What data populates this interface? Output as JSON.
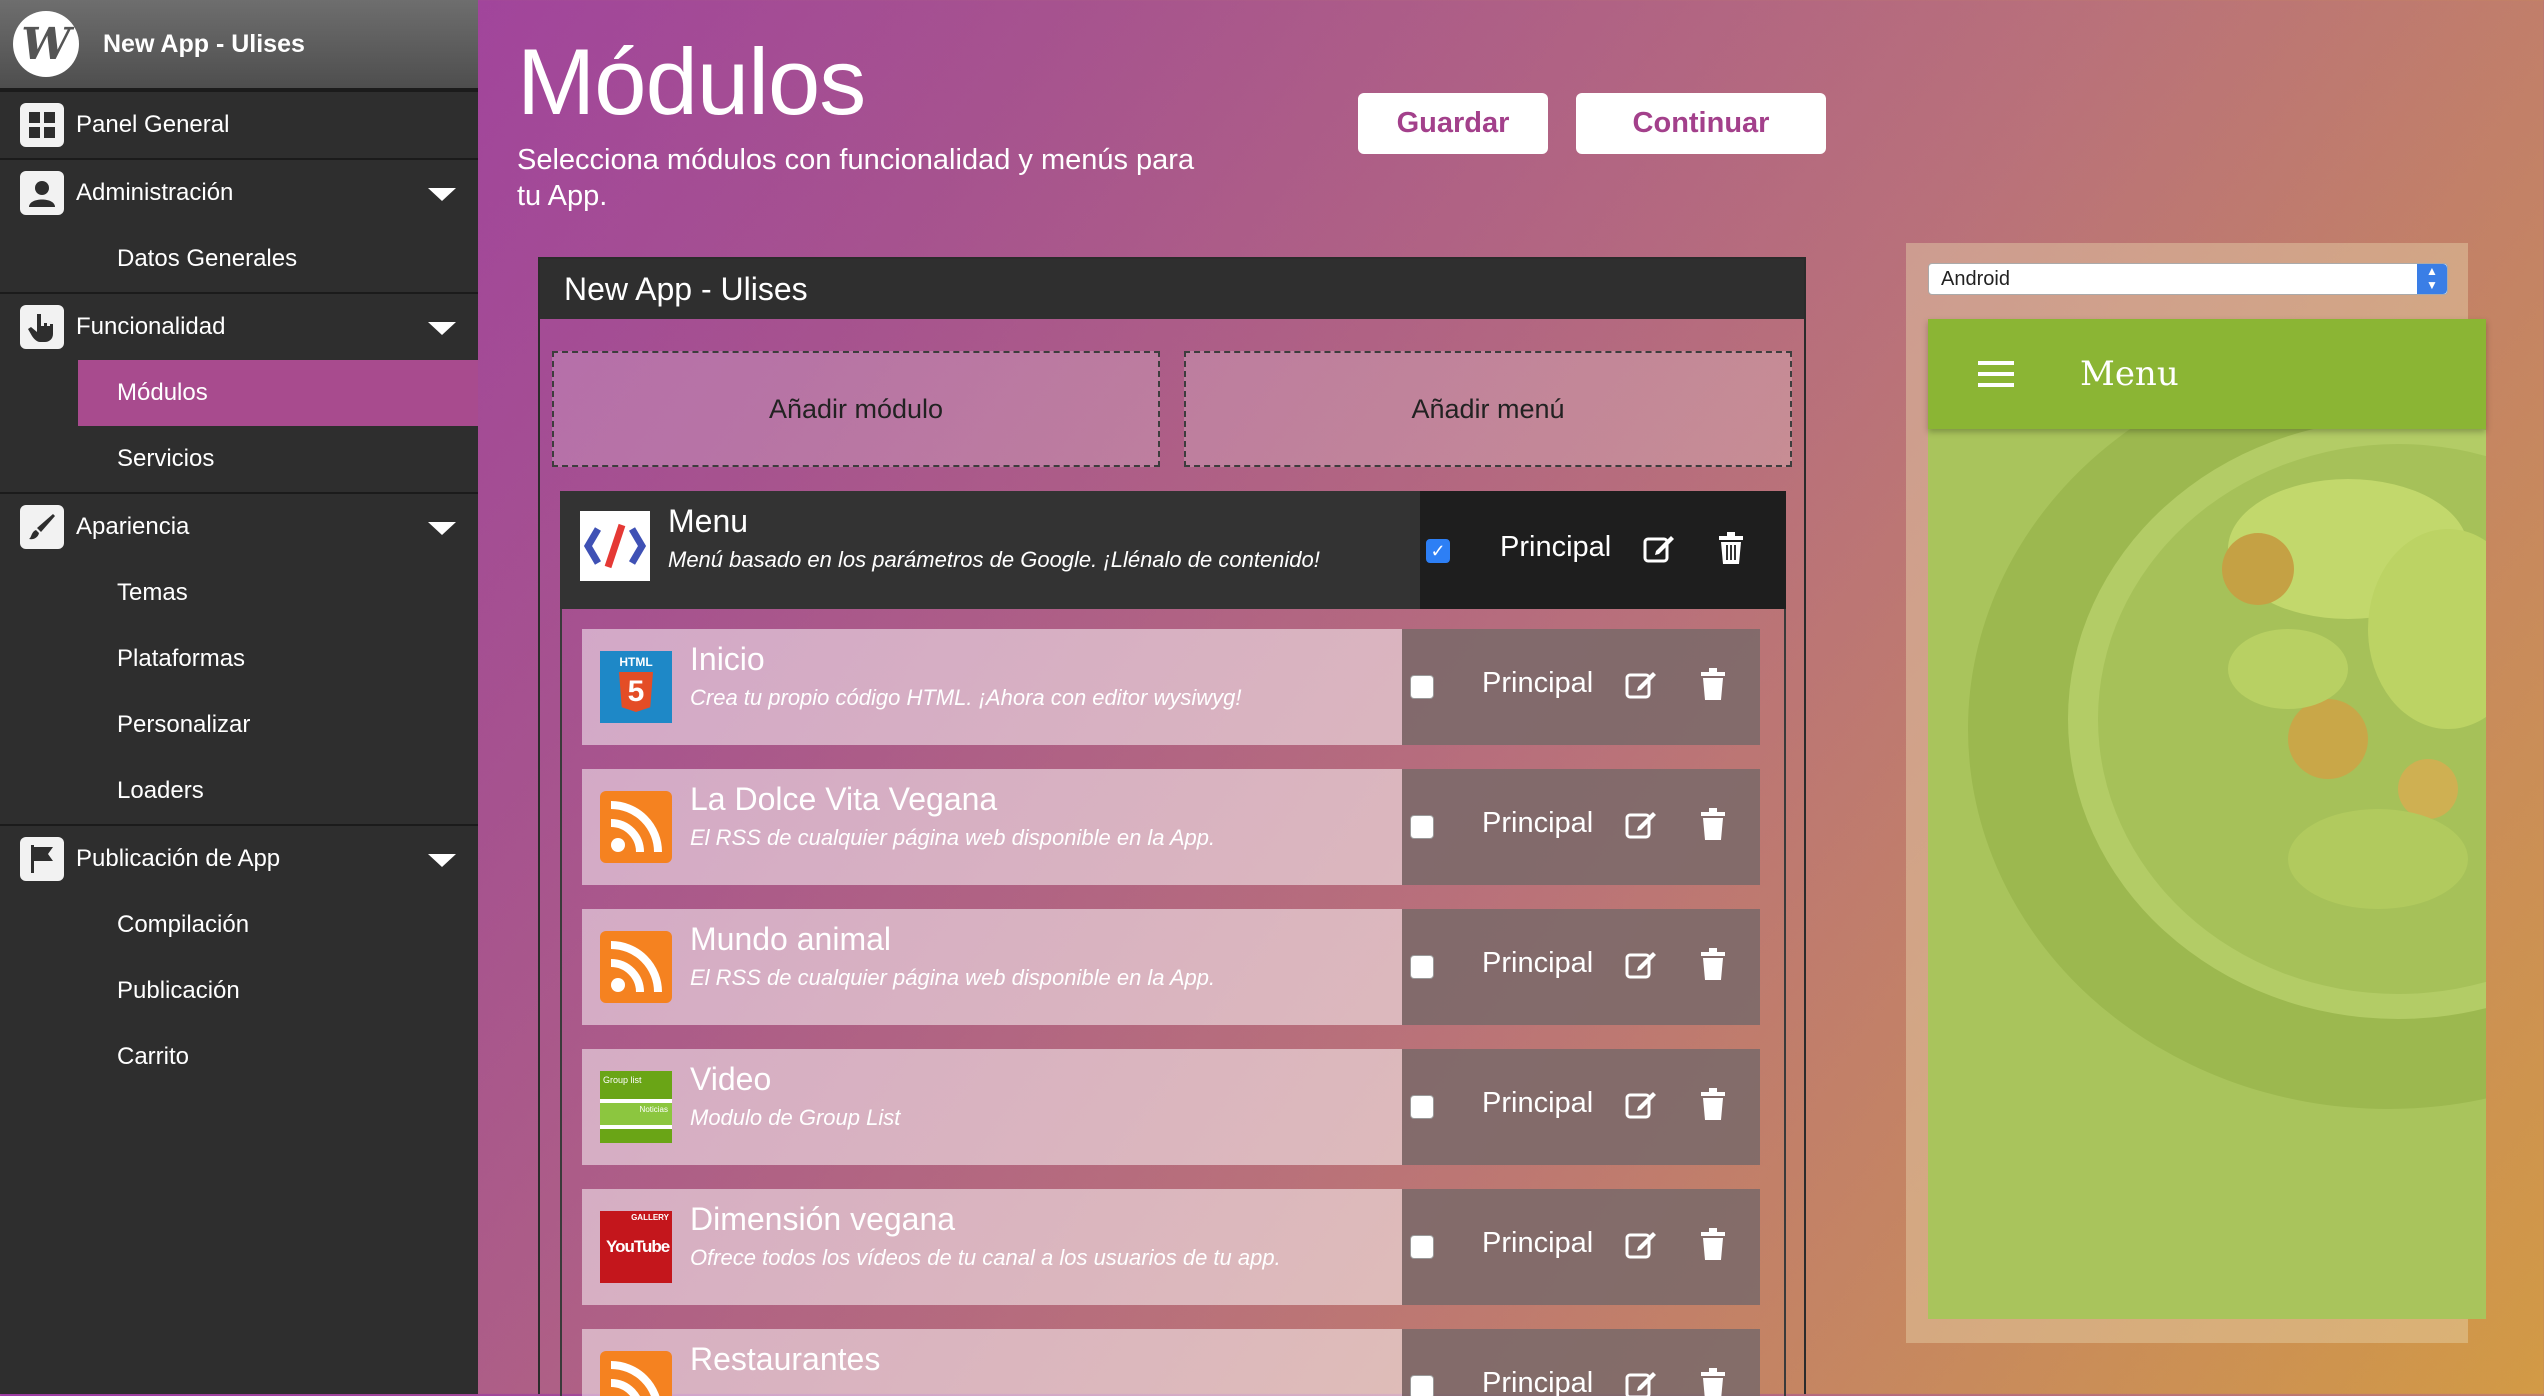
{
  "sidebar": {
    "brand": "New App - Ulises",
    "logo_letter": "W",
    "items": [
      {
        "label": "Panel General",
        "icon": "dashboard-icon"
      },
      {
        "label": "Administración",
        "icon": "user-icon",
        "subs": [
          "Datos Generales"
        ]
      },
      {
        "label": "Funcionalidad",
        "icon": "hand-pointer-icon",
        "subs": [
          "Módulos",
          "Servicios"
        ],
        "active": "Módulos"
      },
      {
        "label": "Apariencia",
        "icon": "brush-icon",
        "subs": [
          "Temas",
          "Plataformas",
          "Personalizar",
          "Loaders"
        ]
      },
      {
        "label": "Publicación de App",
        "icon": "flag-icon",
        "subs": [
          "Compilación",
          "Publicación",
          "Carrito"
        ]
      }
    ]
  },
  "header": {
    "title": "Módulos",
    "subtitle": "Selecciona módulos con funcionalidad y menús para tu App.",
    "save_label": "Guardar",
    "continue_label": "Continuar"
  },
  "panel": {
    "title": "New App - Ulises",
    "add_module": "Añadir módulo",
    "add_menu": "Añadir menú",
    "menu": {
      "name": "Menu",
      "desc": "Menú basado en los parámetros de Google. ¡Llénalo de contenido!",
      "principal": "Principal",
      "checked": true
    },
    "modules": [
      {
        "name": "Inicio",
        "desc": "Crea tu propio código HTML. ¡Ahora con editor wysiwyg!",
        "icon": "html5-icon",
        "principal": "Principal"
      },
      {
        "name": "La Dolce Vita Vegana",
        "desc": "El RSS de cualquier página web disponible en la App.",
        "icon": "rss-icon",
        "principal": "Principal"
      },
      {
        "name": "Mundo animal",
        "desc": "El RSS de cualquier página web disponible en la App.",
        "icon": "rss-icon",
        "principal": "Principal"
      },
      {
        "name": "Video",
        "desc": "Modulo de Group List",
        "icon": "group-list-icon",
        "principal": "Principal"
      },
      {
        "name": "Dimensión vegana",
        "desc": "Ofrece todos los vídeos de tu canal a los usuarios de tu app.",
        "icon": "youtube-icon",
        "principal": "Principal"
      },
      {
        "name": "Restaurantes",
        "desc": "",
        "icon": "rss-icon",
        "principal": "Principal"
      }
    ],
    "icon_texts": {
      "html": "HTML",
      "html_num": "5",
      "group1": "Group list",
      "group2": "Noticias",
      "yt_top": "GALLERY",
      "yt": "YouTube"
    }
  },
  "preview": {
    "platform": "Android",
    "app_title": "Menu"
  },
  "colors": {
    "accent": "#a3408b",
    "sidebar": "#2e2e2e",
    "appbar": "#8bb534"
  }
}
